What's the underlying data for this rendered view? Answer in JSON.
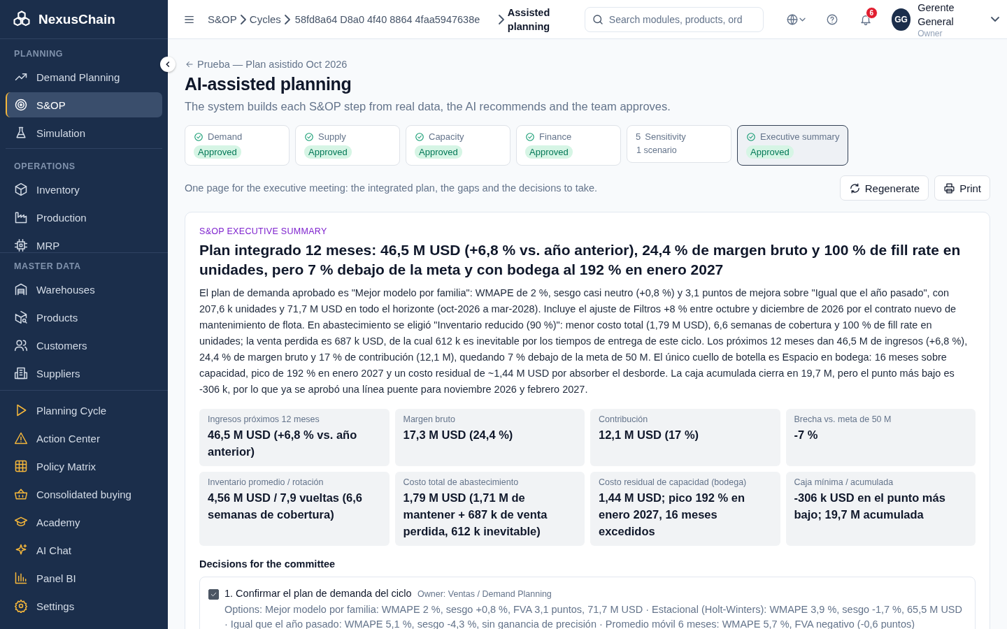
{
  "sidebar": {
    "brand": "NexusChain",
    "sections": [
      {
        "title": "PLANNING",
        "items": [
          {
            "label": "Demand Planning",
            "selected": false
          },
          {
            "label": "S&OP",
            "selected": true
          },
          {
            "label": "Simulation",
            "selected": false
          }
        ]
      },
      {
        "title": "OPERATIONS",
        "items": [
          {
            "label": "Inventory",
            "selected": false
          },
          {
            "label": "Production",
            "selected": false
          },
          {
            "label": "MRP",
            "selected": false
          }
        ]
      },
      {
        "title": "MASTER DATA",
        "items": [
          {
            "label": "Warehouses",
            "selected": false
          },
          {
            "label": "Products",
            "selected": false
          },
          {
            "label": "Customers",
            "selected": false
          },
          {
            "label": "Suppliers",
            "selected": false
          }
        ]
      },
      {
        "items": [
          {
            "label": "Planning Cycle",
            "selected": false
          },
          {
            "label": "Action Center",
            "selected": false
          },
          {
            "label": "Policy Matrix",
            "selected": false
          },
          {
            "label": "Consolidated buying",
            "selected": false
          },
          {
            "label": "Academy",
            "selected": false
          },
          {
            "label": "AI Chat",
            "selected": false
          },
          {
            "label": "Panel BI",
            "selected": false
          },
          {
            "label": "Settings",
            "selected": false
          }
        ]
      }
    ]
  },
  "topbar": {
    "breadcrumb": [
      "S&OP",
      "Cycles",
      "58fd8a64 D8a0 4f40 8864 4faa5947638e",
      "Assisted planning"
    ],
    "search": {
      "placeholder": "Search modules, products, ord"
    },
    "notifications": "6",
    "user": {
      "initials": "GG",
      "name": "Gerente General",
      "role": "Owner"
    }
  },
  "page": {
    "back": "Prueba — Plan asistido Oct 2026",
    "title": "AI-assisted planning",
    "subtitle": "The system builds each S&OP step from real data, the AI recommends and the team approves.",
    "steps": [
      {
        "kind": "approved",
        "label": "Demand",
        "status": "Approved",
        "selected": false
      },
      {
        "kind": "approved",
        "label": "Supply",
        "status": "Approved",
        "selected": false
      },
      {
        "kind": "approved",
        "label": "Capacity",
        "status": "Approved",
        "selected": false
      },
      {
        "kind": "approved",
        "label": "Finance",
        "status": "Approved",
        "selected": false
      },
      {
        "kind": "pending",
        "number": "5",
        "label": "Sensitivity",
        "status": "1 scenario",
        "selected": false
      },
      {
        "kind": "approved",
        "label": "Executive summary",
        "status": "Approved",
        "selected": true
      }
    ],
    "description": "One page for the executive meeting: the integrated plan, the gaps and the decisions to take.",
    "buttons": [
      {
        "label": "Regenerate"
      },
      {
        "label": "Print"
      }
    ]
  },
  "summary": {
    "eyebrow": "S&OP EXECUTIVE SUMMARY",
    "headline": "Plan integrado 12 meses: 46,5 M USD (+6,8 % vs. año anterior), 24,4 % de margen bruto y 100 % de fill rate en unidades, pero 7 % debajo de la meta y con bodega al 192 % en enero 2027",
    "body": "El plan de demanda aprobado es \"Mejor modelo por familia\": WMAPE de 2 %, sesgo casi neutro (+0,8 %) y 3,1 puntos de mejora sobre \"Igual que el año pasado\", con 207,6 k unidades y 71,7 M USD en todo el horizonte (oct-2026 a mar-2028). Incluye el ajuste de Filtros +8 % entre octubre y diciembre de 2026 por el contrato nuevo de mantenimiento de flota. En abastecimiento se eligió \"Inventario reducido (90 %)\": menor costo total (1,79 M USD), 6,6 semanas de cobertura y 100 % de fill rate en unidades; la venta perdida es 687 k USD, de la cual 612 k es inevitable por los tiempos de entrega de este ciclo. Los próximos 12 meses dan 46,5 M de ingresos (+6,8 %), 24,4 % de margen bruto y 17 % de contribución (12,1 M), quedando 7 % debajo de la meta de 50 M. El único cuello de botella es Espacio en bodega: 16 meses sobre capacidad, pico de 192 % en enero 2027 y un costo residual de ~1,44 M USD por absorber el desborde. La caja acumulada cierra en 19,7 M, pero el punto más bajo es -306 k, por lo que ya se aprobó una línea puente para noviembre 2026 y febrero 2027.",
    "metrics": [
      {
        "label": "Ingresos próximos 12 meses",
        "value": "46,5 M USD (+6,8 % vs. año anterior)"
      },
      {
        "label": "Margen bruto",
        "value": "17,3 M USD (24,4 %)"
      },
      {
        "label": "Contribución",
        "value": "12,1 M USD (17 %)"
      },
      {
        "label": "Brecha vs. meta de 50 M",
        "value": "-7 %"
      },
      {
        "label": "Inventario promedio / rotación",
        "value": "4,56 M USD / 7,9 vueltas (6,6 semanas de cobertura)"
      },
      {
        "label": "Costo total de abastecimiento",
        "value": "1,79 M USD (1,71 M de mantener + 687 k de venta perdida, 612 k inevitable)"
      },
      {
        "label": "Costo residual de capacidad (bodega)",
        "value": "1,44 M USD; pico 192 % en enero 2027, 16 meses excedidos"
      },
      {
        "label": "Caja mínima / acumulada",
        "value": "-306 k USD en el punto más bajo; 19,7 M acumulada"
      }
    ],
    "decisions_title": "Decisions for the committee",
    "decisions": [
      {
        "title": "1. Confirmar el plan de demanda del ciclo",
        "checked": true,
        "owner": "Owner: Ventas / Demand Planning",
        "options": "Options: Mejor modelo por familia: WMAPE 2 %, sesgo +0,8 %, FVA 3,1 puntos, 71,7 M USD · Estacional (Holt-Winters): WMAPE 3,9 %, sesgo -1,7 %, 65,5 M USD · Igual que el año pasado: WMAPE 5,1 %, sesgo -4,3 %, sin ganancia de precisión · Promedio móvil 6 meses: WMAPE 5,7 %, FVA negativo (-0,6 puntos)"
      }
    ]
  }
}
